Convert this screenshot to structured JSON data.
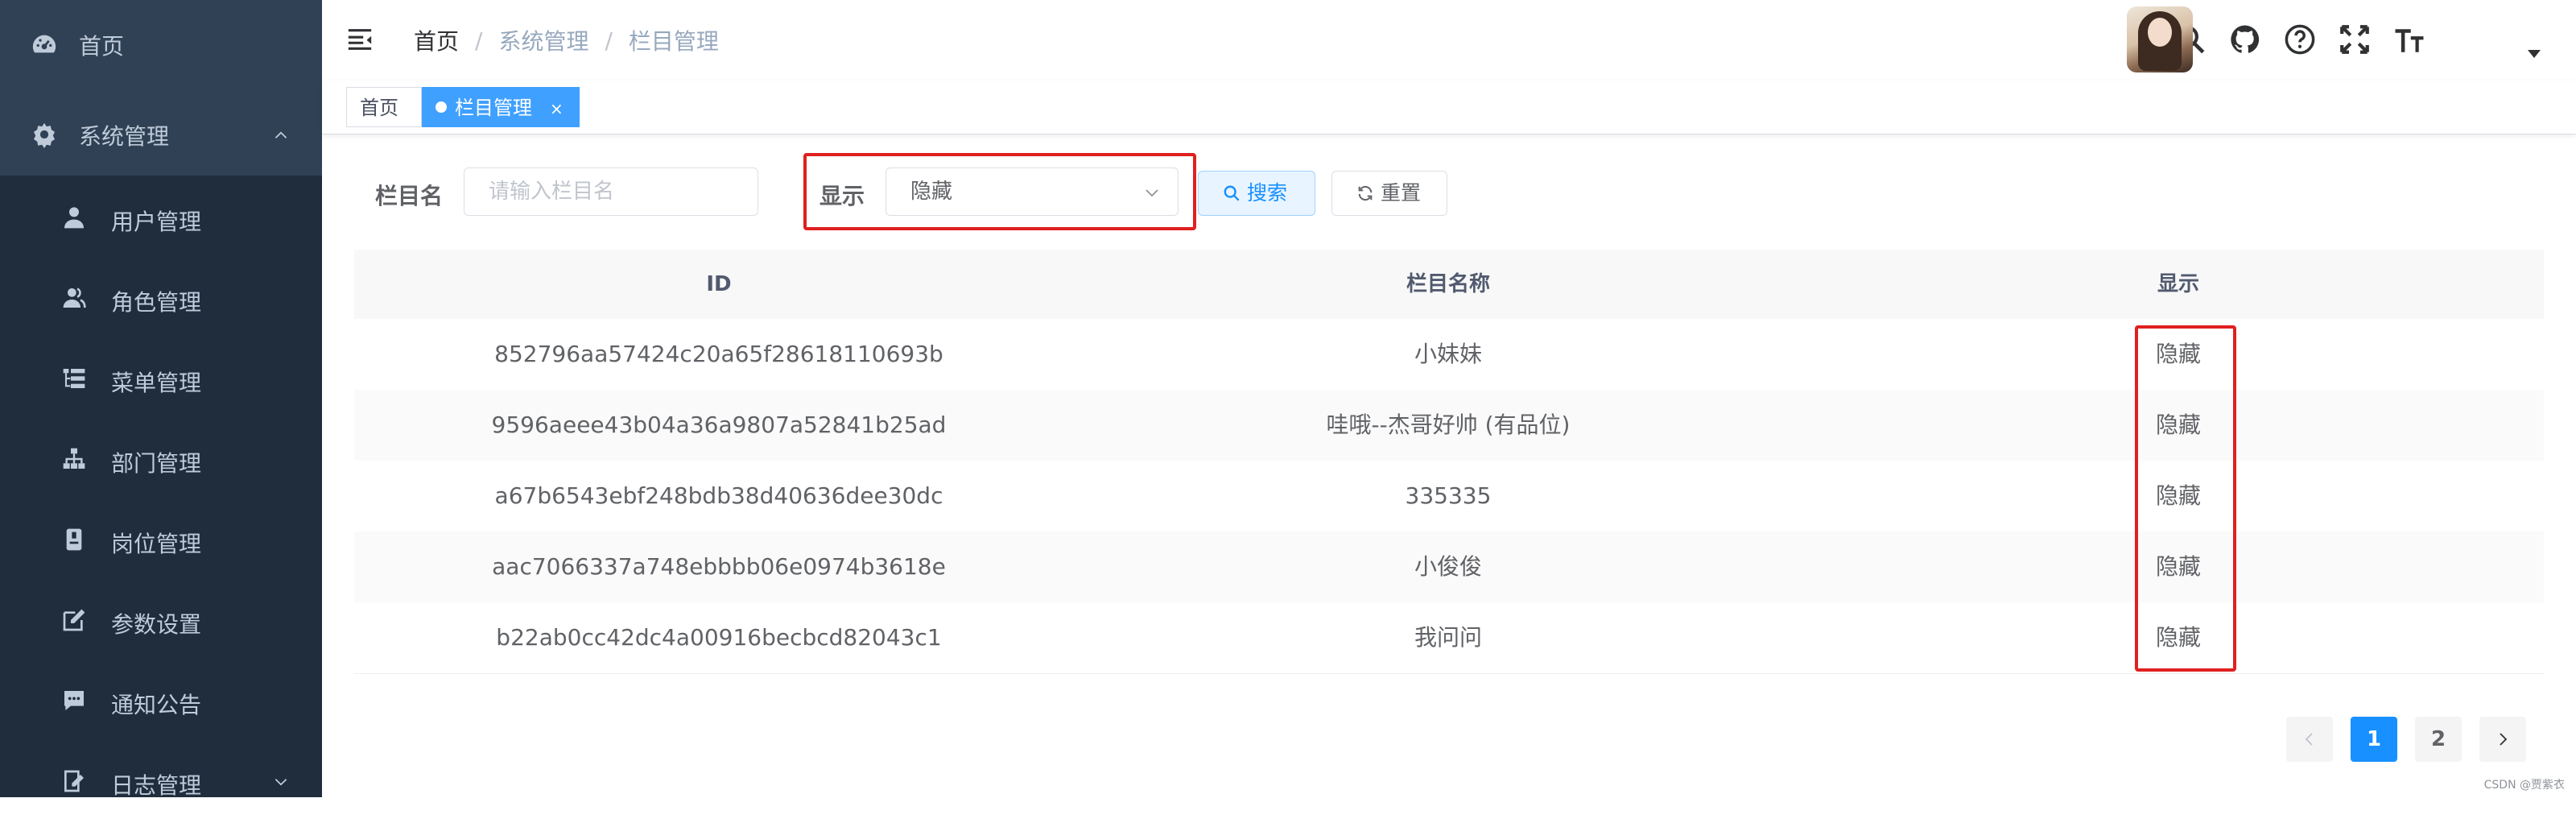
{
  "sidebar": {
    "home": "首页",
    "system": "系统管理",
    "items": [
      {
        "label": "用户管理",
        "icon": "user-icon"
      },
      {
        "label": "角色管理",
        "icon": "peoples-icon"
      },
      {
        "label": "菜单管理",
        "icon": "tree-table-icon"
      },
      {
        "label": "部门管理",
        "icon": "tree-icon"
      },
      {
        "label": "岗位管理",
        "icon": "post-icon"
      },
      {
        "label": "参数设置",
        "icon": "edit-icon"
      },
      {
        "label": "通知公告",
        "icon": "message-icon"
      },
      {
        "label": "日志管理",
        "icon": "log-icon"
      }
    ]
  },
  "navbar": {
    "breadcrumb": [
      "首页",
      "系统管理",
      "栏目管理"
    ],
    "icons": [
      "search-icon",
      "github-icon",
      "question-icon",
      "fullscreen-icon",
      "font-size-icon"
    ]
  },
  "tags": {
    "home": "首页",
    "active": "栏目管理",
    "close": "×"
  },
  "form": {
    "name_label": "栏目名",
    "name_placeholder": "请输入栏目名",
    "show_label": "显示",
    "show_value": "隐藏",
    "search_btn": "搜索",
    "reset_btn": "重置"
  },
  "table": {
    "headers": [
      "ID",
      "栏目名称",
      "显示"
    ],
    "rows": [
      [
        "852796aa57424c20a65f28618110693b",
        "小妹妹",
        "隐藏"
      ],
      [
        "9596aeee43b04a36a9807a52841b25ad",
        "哇哦--杰哥好帅 (有品位)",
        "隐藏"
      ],
      [
        "a67b6543ebf248bdb38d40636dee30dc",
        "335335",
        "隐藏"
      ],
      [
        "aac7066337a748ebbbb06e0974b3618e",
        "小俊俊",
        "隐藏"
      ],
      [
        "b22ab0cc42dc4a00916becbcd82043c1",
        "我问问",
        "隐藏"
      ]
    ]
  },
  "pagination": {
    "pages": [
      "1",
      "2"
    ],
    "current": "1"
  },
  "watermark": "CSDN @贾紫衣",
  "colors": {
    "sidebar_bg": "#304156",
    "submenu_bg": "#1f2d3d",
    "primary": "#1890ff",
    "highlight_box": "#e02020"
  }
}
